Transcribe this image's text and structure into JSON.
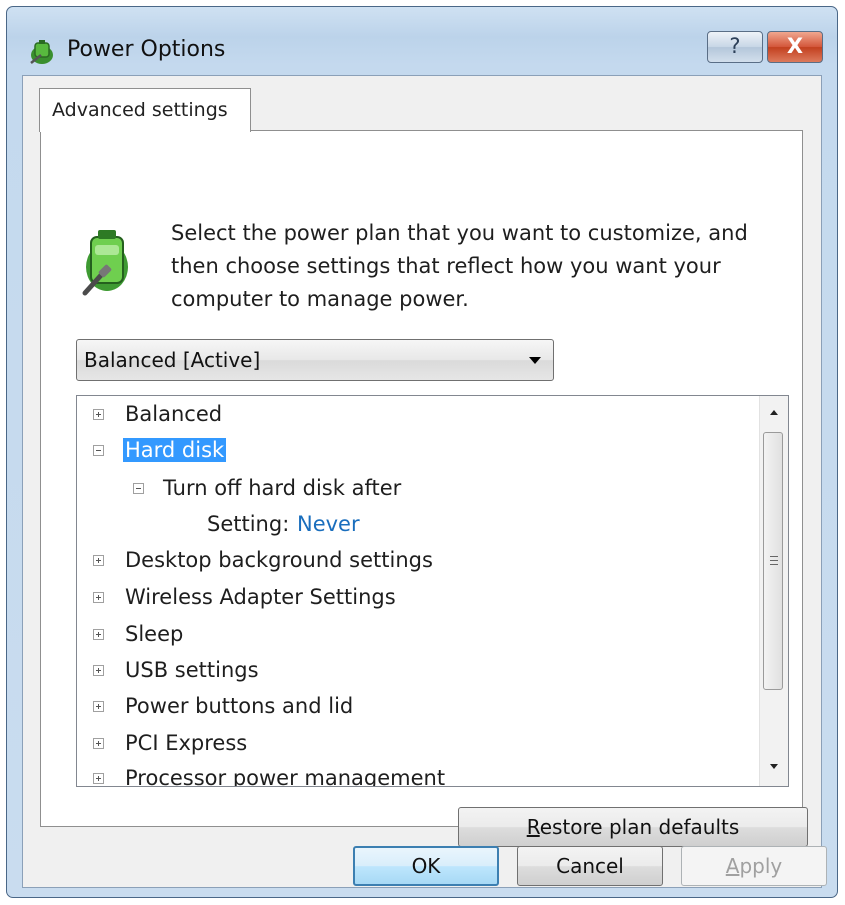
{
  "window": {
    "title": "Power Options"
  },
  "titlebar": {
    "help_glyph": "?",
    "close_glyph": "X"
  },
  "tabs": [
    {
      "label": "Advanced settings"
    }
  ],
  "intro_text": "Select the power plan that you want to customize, and then choose settings that reflect how you want your computer to manage power.",
  "plan_dropdown": {
    "selected": "Balanced [Active]"
  },
  "tree": {
    "items": [
      {
        "label": "Balanced",
        "state": "collapsed"
      },
      {
        "label": "Hard disk",
        "state": "expanded",
        "selected": true
      },
      {
        "label": "Turn off hard disk after",
        "state": "expanded"
      },
      {
        "label": "Setting:",
        "value": "Never"
      },
      {
        "label": "Desktop background settings",
        "state": "collapsed"
      },
      {
        "label": "Wireless Adapter Settings",
        "state": "collapsed"
      },
      {
        "label": "Sleep",
        "state": "collapsed"
      },
      {
        "label": "USB settings",
        "state": "collapsed"
      },
      {
        "label": "Power buttons and lid",
        "state": "collapsed"
      },
      {
        "label": "PCI Express",
        "state": "collapsed"
      },
      {
        "label": "Processor power management",
        "state": "collapsed"
      }
    ]
  },
  "buttons": {
    "restore_pre": "",
    "restore_key": "R",
    "restore_post": "estore plan defaults",
    "ok": "OK",
    "cancel": "Cancel",
    "apply_key": "A",
    "apply_post": "pply"
  },
  "colors": {
    "selection": "#3399ff",
    "link": "#1a6ebd",
    "window_border": "#4a6787",
    "close_button": "#c2401f"
  },
  "icons": [
    "power-options-icon",
    "battery-plug-icon",
    "help-icon",
    "close-icon",
    "dropdown-arrow-icon",
    "expand-icon",
    "collapse-icon",
    "scroll-up-icon",
    "scroll-down-icon"
  ]
}
